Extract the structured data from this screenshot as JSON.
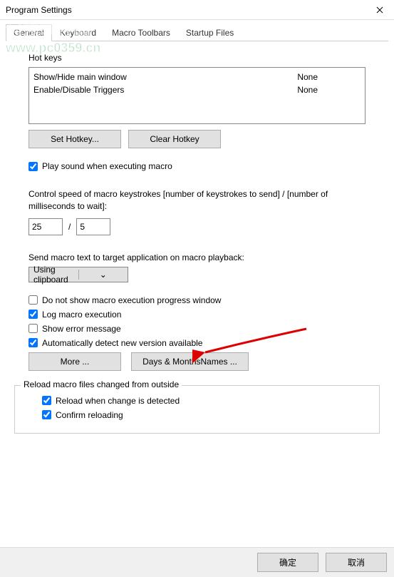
{
  "titlebar": {
    "title": "Program Settings"
  },
  "tabs": {
    "t0": "General",
    "t1": "Keyboard",
    "t2": "Macro Toolbars",
    "t3": "Startup Files"
  },
  "hotkeys": {
    "label": "Hot keys",
    "rows": [
      {
        "name": "Show/Hide main window",
        "value": "None"
      },
      {
        "name": "Enable/Disable Triggers",
        "value": "None"
      }
    ],
    "set_btn": "Set Hotkey...",
    "clear_btn": "Clear Hotkey"
  },
  "playsound": {
    "label": "Play sound when executing macro"
  },
  "speed": {
    "label": "Control speed of macro keystrokes [number of keystrokes to send] / [number of milliseconds to wait]:",
    "num": "25",
    "slash": "/",
    "den": "5"
  },
  "sendmode": {
    "label": "Send macro text to target application on macro playback:",
    "value": "Using clipboard"
  },
  "opts": {
    "o1": "Do not show macro execution progress window",
    "o2": "Log macro execution",
    "o3": "Show error message",
    "o4": "Automatically detect new version available"
  },
  "more_btn": "More ...",
  "daysmonths_btn": "Days & MonthsNames ...",
  "reload": {
    "legend": "Reload macro files changed from outside",
    "r1": "Reload when change is detected",
    "r2": "Confirm reloading"
  },
  "footer": {
    "ok": "确定",
    "cancel": "取消"
  },
  "watermark": {
    "top": "河东软件园",
    "bot": "www.pc0359.cn"
  }
}
